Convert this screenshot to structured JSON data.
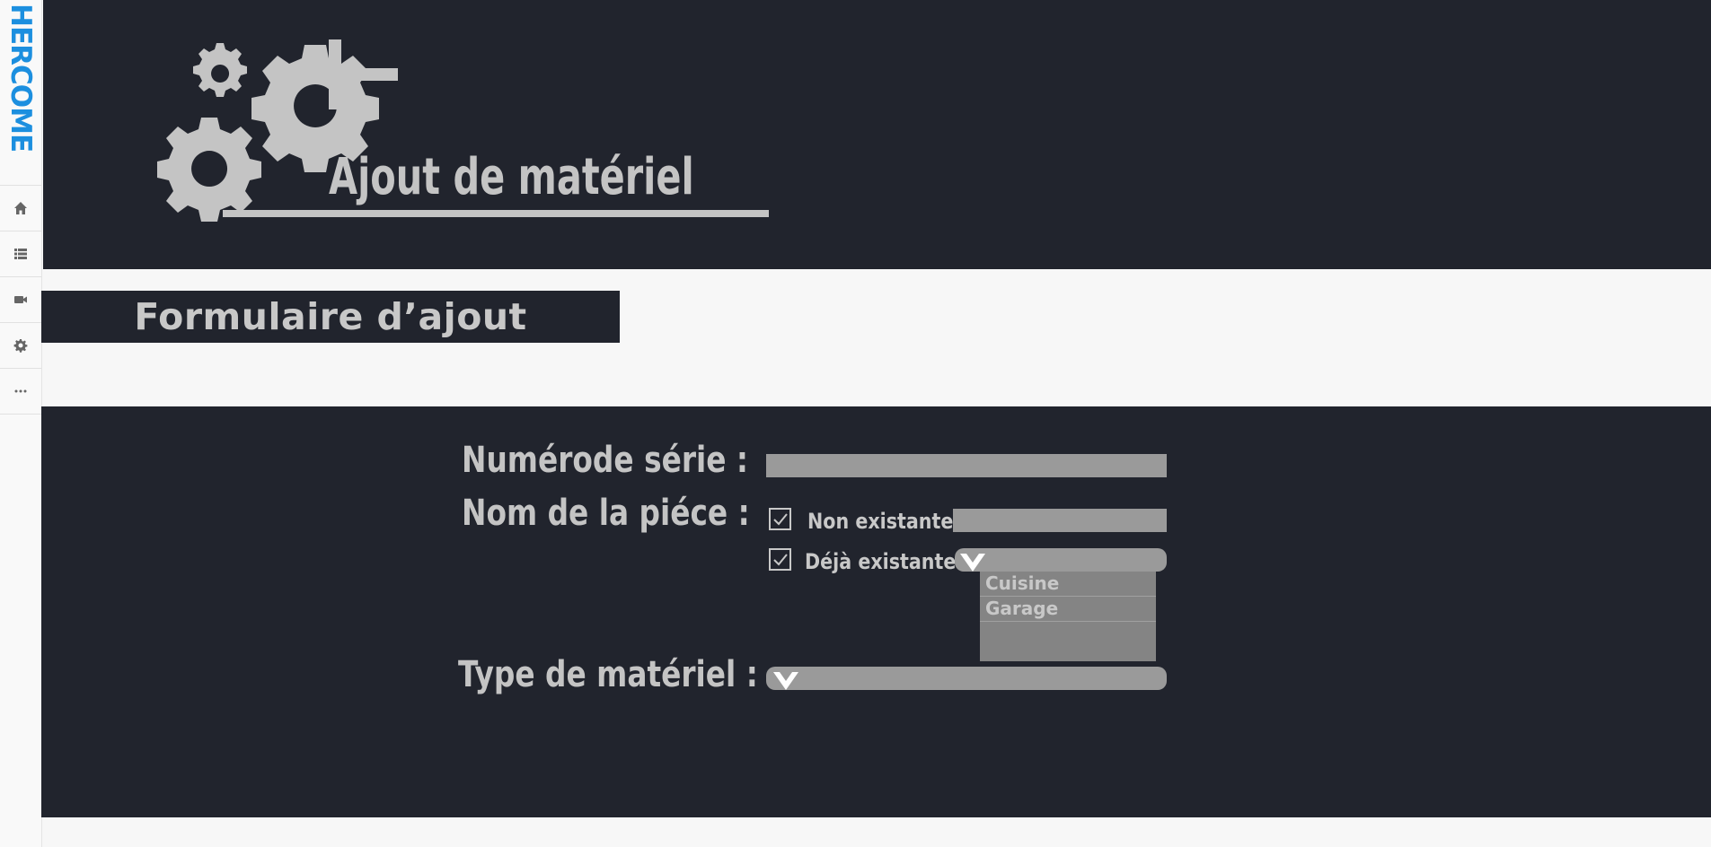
{
  "brand": {
    "name": "HERCOME",
    "color": "#1c8fdf"
  },
  "sidebar": {
    "items": [
      {
        "icon": "home-icon"
      },
      {
        "icon": "list-icon"
      },
      {
        "icon": "video-camera-icon"
      },
      {
        "icon": "gear-icon"
      },
      {
        "icon": "more-dots-icon"
      }
    ]
  },
  "header": {
    "title": "Ajout de matériel",
    "logo_icon": "gears-plus-icon"
  },
  "section": {
    "title": "Formulaire d’ajout"
  },
  "form": {
    "serial_label": "Numérode série :",
    "serial_value": "",
    "piece_label": "Nom de la piéce :",
    "option_new_label": "Non existante",
    "option_new_checked": true,
    "new_piece_value": "",
    "option_existing_label": "Déjà existante",
    "option_existing_checked": true,
    "existing_options": [
      "Cuisine",
      "Garage"
    ],
    "type_label": "Type de matériel :",
    "type_value": ""
  },
  "colors": {
    "dark_panel": "#21242d",
    "text_light": "#c4c4c4",
    "field_gray": "#9a9a9a",
    "page_bg": "#f7f7f7"
  }
}
